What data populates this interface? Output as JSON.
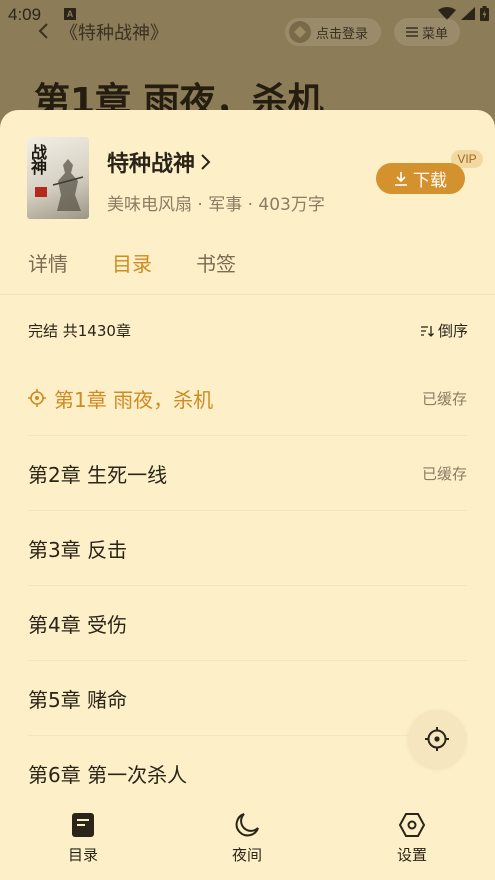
{
  "status_bar": {
    "time": "4:09",
    "notification_icon": "a-letter-icon",
    "icons": [
      "wifi-icon",
      "signal-icon",
      "battery-icon"
    ]
  },
  "top_bar": {
    "back_icon": "chevron-left-icon",
    "book_title": "《特种战神》",
    "login_label": "点击登录",
    "menu_label": "菜单"
  },
  "page": {
    "chapter_heading": "第1章 雨夜，杀机"
  },
  "book": {
    "cover_title": "战神",
    "name": "特种战神",
    "meta": "美味电风扇 · 军事 · 403万字",
    "vip_badge": "VIP",
    "download_label": "下载"
  },
  "tabs": [
    {
      "label": "详情",
      "active": false
    },
    {
      "label": "目录",
      "active": true
    },
    {
      "label": "书签",
      "active": false
    }
  ],
  "catalog": {
    "summary": "完结 共1430章",
    "sort_label": "倒序",
    "chapters": [
      {
        "title": "第1章 雨夜，杀机",
        "status": "已缓存",
        "current": true
      },
      {
        "title": "第2章 生死一线",
        "status": "已缓存",
        "current": false
      },
      {
        "title": "第3章 反击",
        "status": "",
        "current": false
      },
      {
        "title": "第4章 受伤",
        "status": "",
        "current": false
      },
      {
        "title": "第5章 赌命",
        "status": "",
        "current": false
      },
      {
        "title": "第6章 第一次杀人",
        "status": "",
        "current": false
      }
    ]
  },
  "bottom_nav": [
    {
      "label": "目录",
      "icon": "book-icon"
    },
    {
      "label": "夜间",
      "icon": "moon-icon"
    },
    {
      "label": "设置",
      "icon": "hexagon-settings-icon"
    }
  ],
  "colors": {
    "accent": "#d4922e",
    "sheet_background": "#fdf0c9",
    "dim_background": "#8c7c57"
  }
}
